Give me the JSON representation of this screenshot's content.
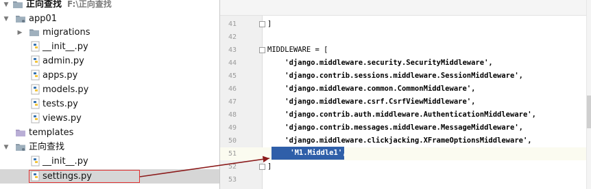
{
  "tree": {
    "root": {
      "name": "正向查找",
      "path": "F:\\正向查找"
    },
    "items": [
      {
        "label": "app01"
      },
      {
        "label": "migrations"
      },
      {
        "label": "__init__.py"
      },
      {
        "label": "admin.py"
      },
      {
        "label": "apps.py"
      },
      {
        "label": "models.py"
      },
      {
        "label": "tests.py"
      },
      {
        "label": "views.py"
      },
      {
        "label": "templates"
      },
      {
        "label": "正向查找"
      },
      {
        "label": "__init__.py"
      },
      {
        "label": "settings.py"
      }
    ]
  },
  "editor": {
    "lines": [
      {
        "num": "41",
        "text": "]"
      },
      {
        "num": "42",
        "text": ""
      },
      {
        "num": "43",
        "text": "MIDDLEWARE = ["
      },
      {
        "num": "44",
        "text": "    'django.middleware.security.SecurityMiddleware',"
      },
      {
        "num": "45",
        "text": "    'django.contrib.sessions.middleware.SessionMiddleware',"
      },
      {
        "num": "46",
        "text": "    'django.middleware.common.CommonMiddleware',"
      },
      {
        "num": "47",
        "text": "    'django.middleware.csrf.CsrfViewMiddleware',"
      },
      {
        "num": "48",
        "text": "    'django.contrib.auth.middleware.AuthenticationMiddleware',"
      },
      {
        "num": "49",
        "text": "    'django.contrib.messages.middleware.MessageMiddleware',"
      },
      {
        "num": "50",
        "text": "    'django.middleware.clickjacking.XFrameOptionsMiddleware',"
      },
      {
        "num": "51",
        "text": "    'M1.Middle1',"
      },
      {
        "num": "52",
        "text": "]"
      },
      {
        "num": "53",
        "text": ""
      }
    ]
  },
  "colors": {
    "selection": "#2f5fa9",
    "annotation_red": "#e03030",
    "arrow": "#8b1a1a",
    "string_green": "#2f7d1f"
  },
  "icons": {
    "folder": "folder-icon",
    "python_file": "python-file-icon",
    "expand_arrow": "triangle-down-icon",
    "collapsed_arrow": "triangle-right-icon"
  }
}
